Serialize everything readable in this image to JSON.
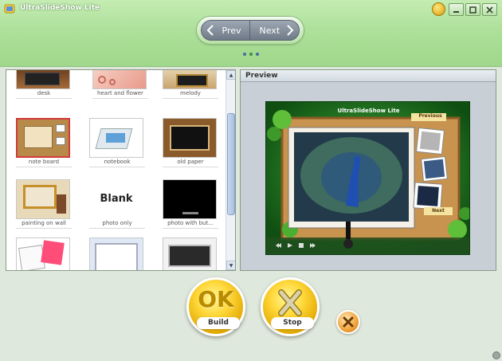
{
  "window": {
    "title": "UltraSlideShow Lite",
    "controls": [
      "help",
      "minimize",
      "maximize",
      "close"
    ]
  },
  "nav": {
    "prev_label": "Prev",
    "next_label": "Next",
    "page_dots": 3,
    "active_dot": 2
  },
  "templates": [
    {
      "label": "desk"
    },
    {
      "label": "heart and flower"
    },
    {
      "label": "melody"
    },
    {
      "label": "note board",
      "selected": true
    },
    {
      "label": "notebook"
    },
    {
      "label": "old paper"
    },
    {
      "label": "painting on wall"
    },
    {
      "label": "photo only",
      "thumb_text": "Blank"
    },
    {
      "label": "photo with but..."
    },
    {
      "label": ""
    },
    {
      "label": ""
    },
    {
      "label": ""
    }
  ],
  "preview": {
    "header": "Preview",
    "stage_title": "UltraSlideShow Lite",
    "previous_label": "Previous",
    "next_label": "Next"
  },
  "actions": {
    "build_face": "OK",
    "build_label": "Build",
    "stop_label": "Stop"
  },
  "colors": {
    "header_green": "#aee09a",
    "button_gold": "#ffd83a",
    "selection_red": "#d23a3a"
  }
}
